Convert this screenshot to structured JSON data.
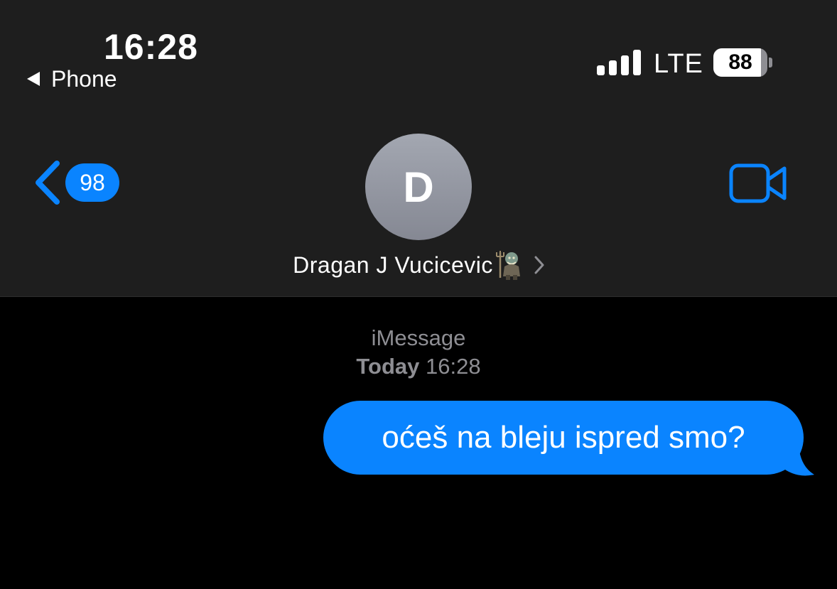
{
  "status_bar": {
    "time": "16:28",
    "back_app_label": "Phone",
    "network": "LTE",
    "battery_percent": "88",
    "battery_level": 0.88,
    "signal_bars": 4
  },
  "nav": {
    "unread_count": "98",
    "avatar_initial": "D",
    "contact_name": "Dragan J Vucicevic",
    "contact_emoji": "troll-with-trident-emoji",
    "video_icon": "video-camera-icon"
  },
  "conversation": {
    "service": "iMessage",
    "timestamp_day": "Today",
    "timestamp_time": "16:28",
    "messages": [
      {
        "direction": "outgoing",
        "text": "oćeš na bleju ispred smo?"
      }
    ]
  },
  "colors": {
    "accent": "#0a84ff",
    "header_bg": "#1e1e1e",
    "background": "#000000",
    "secondary_text": "#8e8e93"
  }
}
